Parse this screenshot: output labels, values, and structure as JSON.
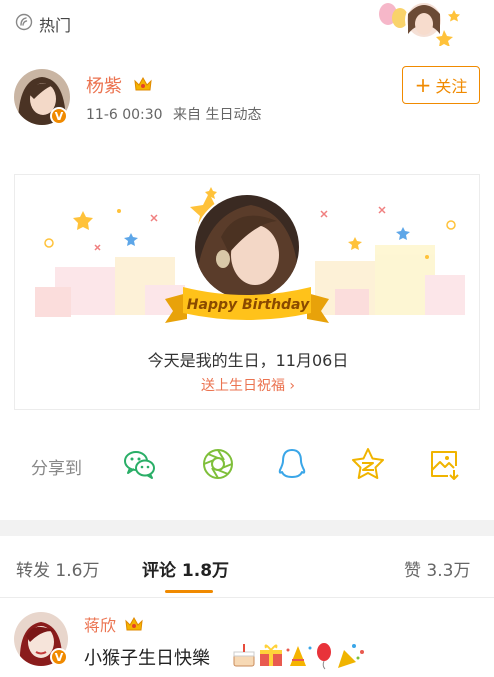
{
  "hotbar": {
    "label": "热门",
    "icon": "hot-icon"
  },
  "post": {
    "author": "杨紫",
    "verified_badge": "V",
    "time": "11-6 00:30",
    "source": "来自 生日动态",
    "follow_label": "关注",
    "follow_icon": "plus-icon"
  },
  "card": {
    "ribbon": "Happy Birthday",
    "message": "今天是我的生日，11月06日",
    "link": "送上生日祝福 ›"
  },
  "share": {
    "label": "分享到",
    "targets": [
      "wechat-icon",
      "moments-icon",
      "qq-icon",
      "qzone-icon",
      "save-image-icon"
    ]
  },
  "tabs": {
    "repost": "转发 1.6万",
    "comments": "评论 1.8万",
    "likes": "赞 3.3万"
  },
  "comment": {
    "author": "蒋欣",
    "verified_badge": "V",
    "text": "小猴子生日快樂"
  },
  "colors": {
    "accent": "#f08a00",
    "name": "#eb7350",
    "wechat": "#2aae67",
    "moments": "#7fbf3a",
    "qq": "#3aa6e8",
    "qzone": "#f0b400"
  }
}
